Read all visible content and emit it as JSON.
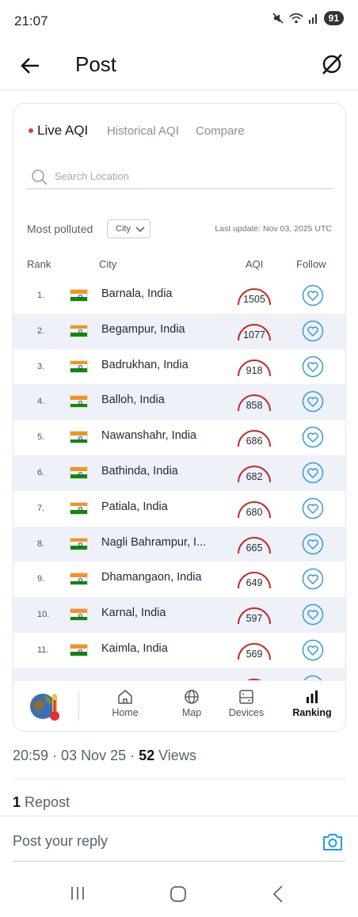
{
  "status_bar": {
    "time": "21:07",
    "battery": "91",
    "icons": [
      "mute-icon",
      "wifi-icon",
      "signal-icon"
    ]
  },
  "appbar": {
    "title": "Post",
    "back_icon": "arrow-left-icon",
    "grok_icon": "grok-icon"
  },
  "aqi_card": {
    "tabs": [
      {
        "label": "Live AQI",
        "active": true
      },
      {
        "label": "Historical AQI",
        "active": false
      },
      {
        "label": "Compare",
        "active": false
      }
    ],
    "search_placeholder": "Search Location",
    "filter_label": "Most polluted",
    "filter_value": "City",
    "last_update": "Last update: Nov 03, 2025 UTC",
    "columns": {
      "rank": "Rank",
      "city": "City",
      "aqi": "AQI",
      "follow": "Follow"
    },
    "rows": [
      {
        "rank": "1.",
        "city": "Barnala, India",
        "aqi": "1505"
      },
      {
        "rank": "2.",
        "city": "Begampur, India",
        "aqi": "1077"
      },
      {
        "rank": "3.",
        "city": "Badrukhan, India",
        "aqi": "918"
      },
      {
        "rank": "4.",
        "city": "Balloh, India",
        "aqi": "858"
      },
      {
        "rank": "5.",
        "city": "Nawanshahr, India",
        "aqi": "686"
      },
      {
        "rank": "6.",
        "city": "Bathinda, India",
        "aqi": "682"
      },
      {
        "rank": "7.",
        "city": "Patiala, India",
        "aqi": "680"
      },
      {
        "rank": "8.",
        "city": "Nagli Bahrampur, I...",
        "aqi": "665"
      },
      {
        "rank": "9.",
        "city": "Dhamangaon, India",
        "aqi": "649"
      },
      {
        "rank": "10.",
        "city": "Karnal, India",
        "aqi": "597"
      },
      {
        "rank": "11.",
        "city": "Kaimla, India",
        "aqi": "569"
      }
    ],
    "accent_color": "#c62828",
    "follow_color": "#3b9ad9",
    "bottom_nav": [
      {
        "label": "Home",
        "icon": "home-icon",
        "active": false
      },
      {
        "label": "Map",
        "icon": "globe-icon",
        "active": false
      },
      {
        "label": "Devices",
        "icon": "device-icon",
        "active": false
      },
      {
        "label": "Ranking",
        "icon": "bar-chart-icon",
        "active": true
      }
    ]
  },
  "post_meta": {
    "time": "20:59 · 03 Nov 25 · ",
    "views_count": "52",
    "views_label": " Views",
    "repost_count": "1",
    "repost_label": " Repost"
  },
  "reply": {
    "placeholder": "Post your reply"
  }
}
